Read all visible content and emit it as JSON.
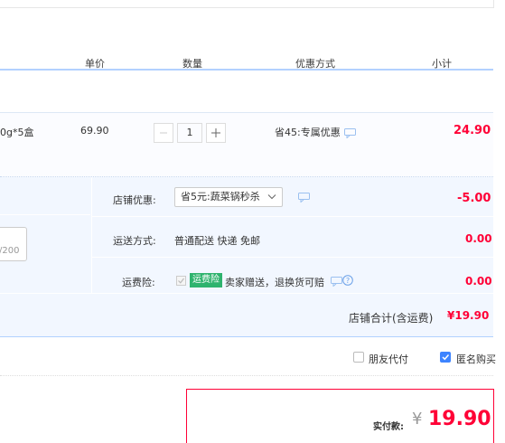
{
  "header": {
    "unit_price": "单价",
    "quantity": "数量",
    "discount_method": "优惠方式",
    "subtotal": "小计"
  },
  "item": {
    "name_fragment": "0g*5盒",
    "unit_price": "69.90",
    "quantity": "1",
    "discount": "省45:专属优惠",
    "subtotal": "24.90"
  },
  "order": {
    "memo_counter": "/200",
    "shop_discount_label": "店铺优惠:",
    "shop_discount_value": "省5元:蔬菜锅秒杀",
    "shop_discount_amount": "-5.00",
    "shipping_label": "运送方式:",
    "shipping_value": "普通配送 快递 免邮",
    "shipping_amount": "0.00",
    "insurance_label": "运费险:",
    "insurance_badge": "运费险",
    "insurance_text": "卖家赠送，退换货可赔",
    "insurance_amount": "0.00",
    "shop_total_label": "店铺合计(含运费)",
    "shop_total_value": "¥19.90"
  },
  "options": {
    "friend_pay": "朋友代付",
    "anonymous": "匿名购买"
  },
  "footer": {
    "actual_label": "实付款:",
    "currency": "¥",
    "actual_value": "19.90"
  },
  "colors": {
    "accent_red": "#ff0036",
    "header_line": "#b2d1ff",
    "panel_bg": "#f2f7ff",
    "checkbox_blue": "#3d84ff"
  }
}
